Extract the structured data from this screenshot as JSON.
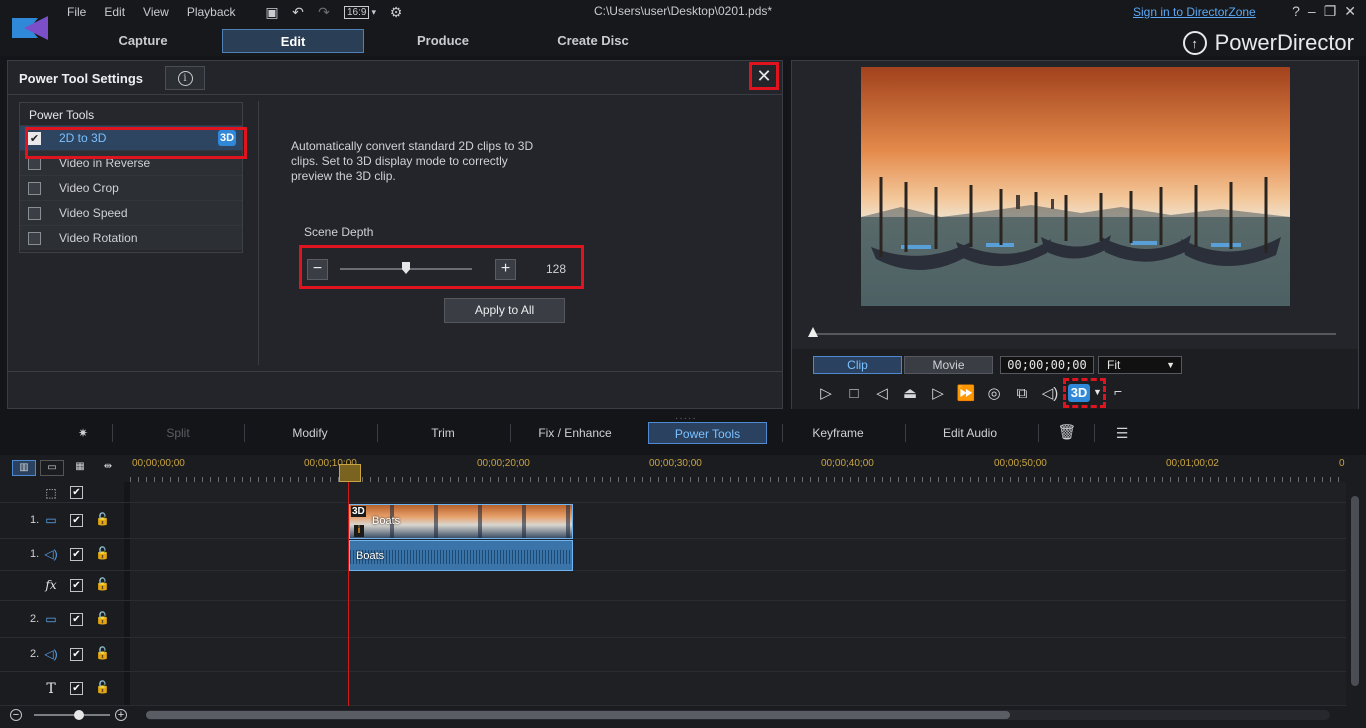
{
  "menu": [
    "File",
    "Edit",
    "View",
    "Playback"
  ],
  "aspect_ratio": "16:9",
  "document_title": "C:\\Users\\user\\Desktop\\0201.pds*",
  "signin_link": "Sign in to DirectorZone",
  "window_controls": {
    "help": "?"
  },
  "tabs": [
    {
      "label": "Capture",
      "active": false
    },
    {
      "label": "Edit",
      "active": true
    },
    {
      "label": "Produce",
      "active": false
    },
    {
      "label": "Create Disc",
      "active": false
    }
  ],
  "brand": "PowerDirector",
  "power_tool_settings": {
    "title": "Power Tool Settings",
    "info_glyph": "i",
    "tools_header": "Power Tools",
    "tools": [
      {
        "label": "2D to 3D",
        "checked": true,
        "badge": "3D"
      },
      {
        "label": "Video in Reverse",
        "checked": false
      },
      {
        "label": "Video Crop",
        "checked": false
      },
      {
        "label": "Video Speed",
        "checked": false
      },
      {
        "label": "Video Rotation",
        "checked": false
      }
    ],
    "description": "Automatically convert standard 2D clips to 3D clips. Set to 3D display mode to correctly preview the 3D clip.",
    "scene_depth_label": "Scene Depth",
    "scene_depth_value": "128",
    "scene_depth_fraction": 0.5,
    "apply_all": "Apply to All"
  },
  "preview": {
    "mode_clip": "Clip",
    "mode_movie": "Movie",
    "timecode": "00;00;00;00",
    "fit": "Fit",
    "btn_3d": "3D"
  },
  "edit_toolbar": {
    "split": "Split",
    "modify": "Modify",
    "trim": "Trim",
    "fix_enhance": "Fix / Enhance",
    "power_tools": "Power Tools",
    "keyframe": "Keyframe",
    "edit_audio": "Edit Audio"
  },
  "timeline": {
    "ruler": [
      "00;00;00;00",
      "00;00;10;00",
      "00;00;20;00",
      "00;00;30;00",
      "00;00;40;00",
      "00;00;50;00",
      "00;01;00;02",
      "0"
    ],
    "tracks": [
      {
        "num": "",
        "type": "master"
      },
      {
        "num": "1.",
        "type": "video"
      },
      {
        "num": "1.",
        "type": "audio"
      },
      {
        "num": "",
        "type": "fx"
      },
      {
        "num": "2.",
        "type": "video"
      },
      {
        "num": "2.",
        "type": "audio"
      },
      {
        "num": "",
        "type": "title"
      }
    ],
    "video_clip": {
      "name": "Boats",
      "badge": "3D"
    },
    "audio_clip": {
      "name": "Boats"
    }
  },
  "colors": {
    "accent": "#2f89d8",
    "highlight": "#e0141e",
    "link": "#5aa8f5"
  }
}
